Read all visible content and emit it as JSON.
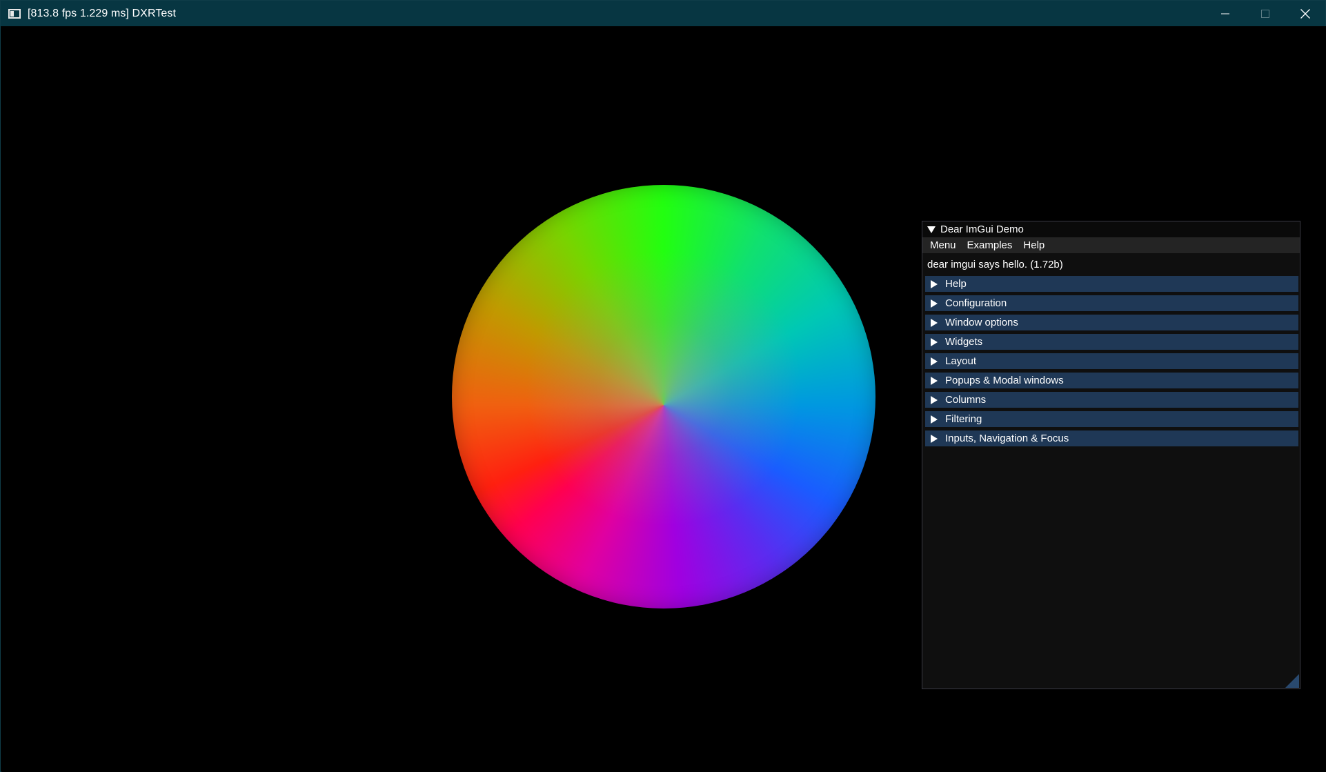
{
  "window": {
    "title": "[813.8 fps  1.229 ms] DXRTest",
    "icon": "app-window-icon",
    "controls": {
      "minimize": "minimize-icon",
      "maximize": "maximize-icon",
      "close": "close-icon"
    },
    "background_color": "#000000",
    "titlebar_color": "#073642"
  },
  "scene": {
    "object": "rainbow-shaded-sphere"
  },
  "imgui": {
    "title": "Dear ImGui Demo",
    "menubar": [
      "Menu",
      "Examples",
      "Help"
    ],
    "hello_text": "dear imgui says hello. (1.72b)",
    "sections": [
      "Help",
      "Configuration",
      "Window options",
      "Widgets",
      "Layout",
      "Popups & Modal windows",
      "Columns",
      "Filtering",
      "Inputs, Navigation & Focus"
    ],
    "colors": {
      "window_bg": "#0f0f0f",
      "header_bg": "#1f3856",
      "menubar_bg": "#242424",
      "grip": "#29496e"
    }
  }
}
